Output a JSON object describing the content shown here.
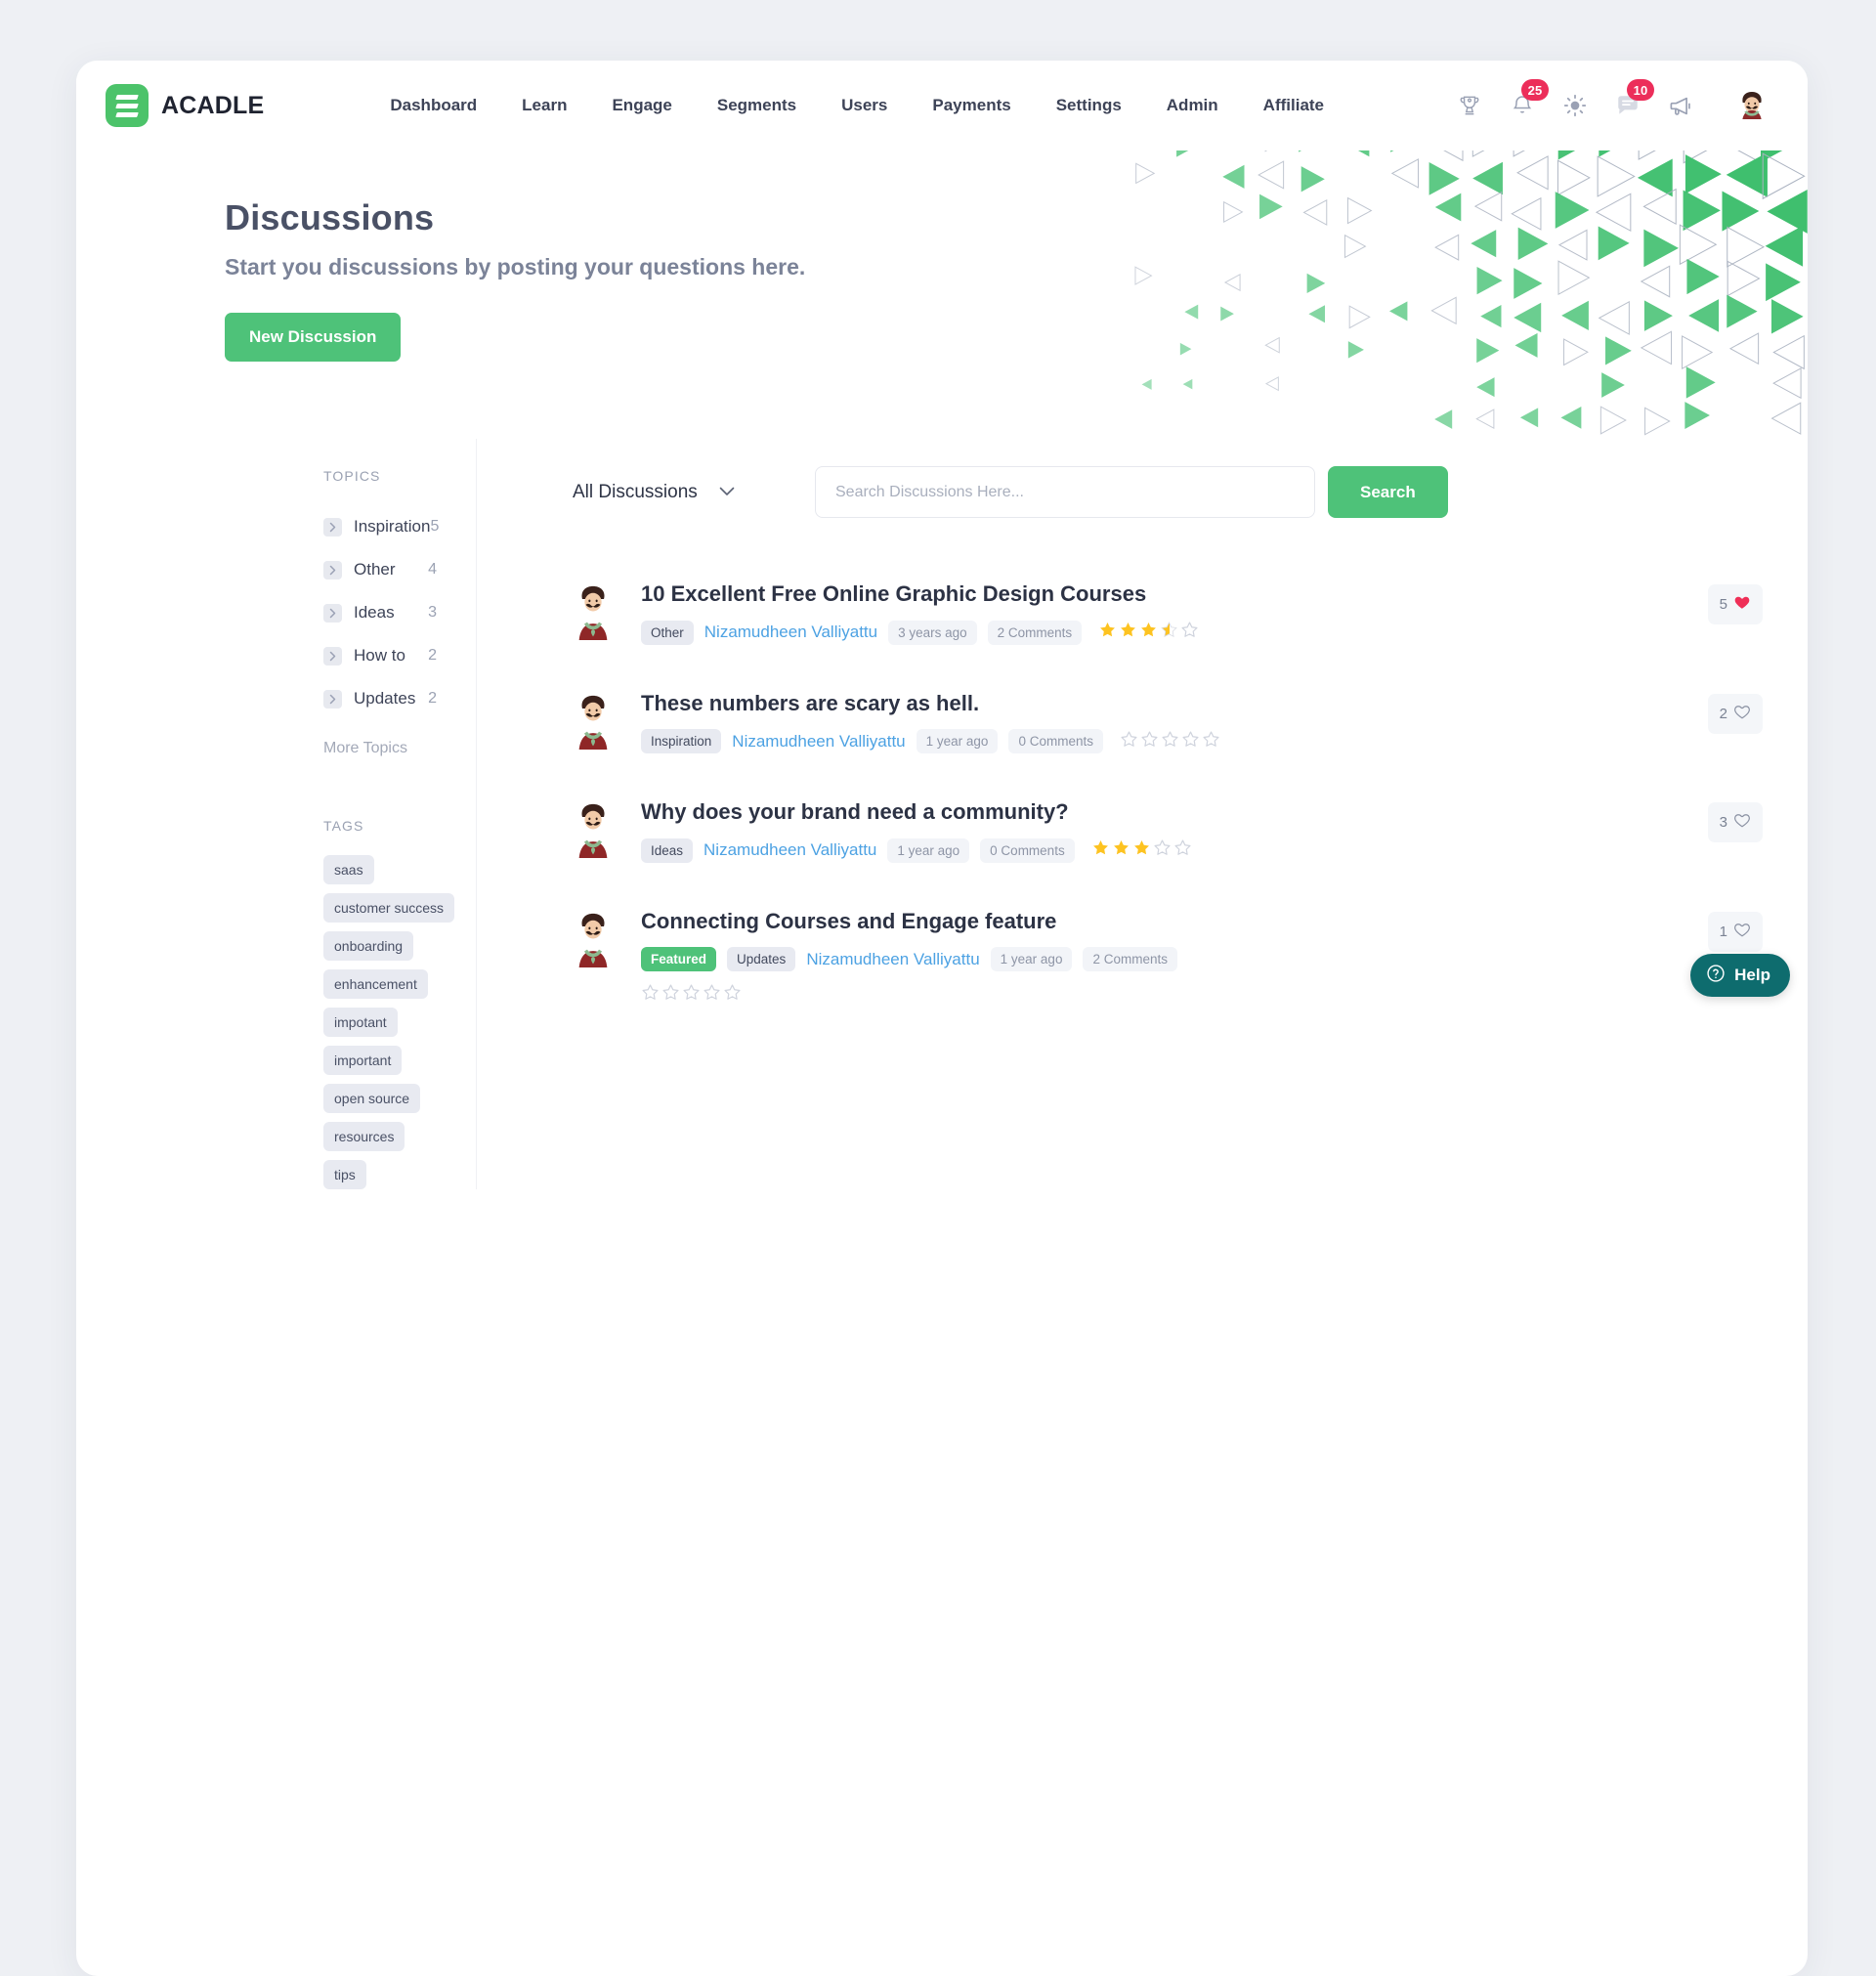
{
  "brand": {
    "name": "ACADLE",
    "color": "#4cc36a"
  },
  "nav": {
    "items": [
      {
        "label": "Dashboard"
      },
      {
        "label": "Learn"
      },
      {
        "label": "Engage"
      },
      {
        "label": "Segments"
      },
      {
        "label": "Users"
      },
      {
        "label": "Payments"
      },
      {
        "label": "Settings"
      },
      {
        "label": "Admin"
      },
      {
        "label": "Affiliate"
      }
    ]
  },
  "header_icons": {
    "trophy": "trophy-icon",
    "bell": "bell-icon",
    "bell_badge": "25",
    "brightness": "sun-icon",
    "messages": "chat-icon",
    "messages_badge": "10",
    "announcement": "megaphone-icon",
    "avatar": "user-avatar"
  },
  "hero": {
    "title": "Discussions",
    "subtitle": "Start you discussions by posting your questions here.",
    "cta_label": "New Discussion",
    "cta_color": "#4ec279"
  },
  "sidebar": {
    "topics_heading": "TOPICS",
    "topics": [
      {
        "label": "Inspiration",
        "count": "5"
      },
      {
        "label": "Other",
        "count": "4"
      },
      {
        "label": "Ideas",
        "count": "3"
      },
      {
        "label": "How to",
        "count": "2"
      },
      {
        "label": "Updates",
        "count": "2"
      }
    ],
    "more_topics": "More Topics",
    "tags_heading": "TAGS",
    "tags": [
      "saas",
      "customer success",
      "onboarding",
      "enhancement",
      "impotant",
      "important",
      "open source",
      "resources",
      "tips"
    ]
  },
  "toolbar": {
    "filter_label": "All Discussions",
    "search_placeholder": "Search Discussions Here...",
    "search_value": "",
    "search_button": "Search"
  },
  "discussions": [
    {
      "title": "10 Excellent Free Online Graphic Design Courses",
      "featured": false,
      "topic": "Other",
      "author": "Nizamudheen Valliyattu",
      "time": "3 years ago",
      "comments": "2 Comments",
      "rating": 3.5,
      "likes": "5",
      "liked": true,
      "stars_wrapped": false
    },
    {
      "title": "These numbers are scary as hell.",
      "featured": false,
      "topic": "Inspiration",
      "author": "Nizamudheen Valliyattu",
      "time": "1 year ago",
      "comments": "0 Comments",
      "rating": 0,
      "likes": "2",
      "liked": false,
      "stars_wrapped": false
    },
    {
      "title": "Why does your brand need a community?",
      "featured": false,
      "topic": "Ideas",
      "author": "Nizamudheen Valliyattu",
      "time": "1 year ago",
      "comments": "0 Comments",
      "rating": 3,
      "likes": "3",
      "liked": false,
      "stars_wrapped": false
    },
    {
      "title": "Connecting Courses and Engage feature",
      "featured": true,
      "featured_label": "Featured",
      "topic": "Updates",
      "author": "Nizamudheen Valliyattu",
      "time": "1 year ago",
      "comments": "2 Comments",
      "rating": 0,
      "likes": "1",
      "liked": false,
      "stars_wrapped": true
    }
  ],
  "help": {
    "label": "Help",
    "icon": "question-circle-icon",
    "color": "#0e6c6e"
  }
}
